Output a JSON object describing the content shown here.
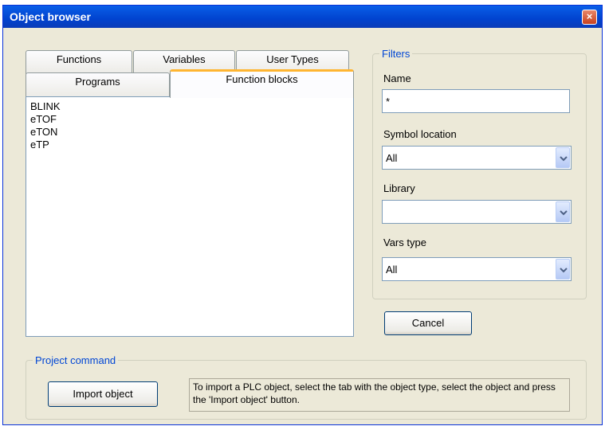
{
  "window": {
    "title": "Object browser",
    "close_label": "×"
  },
  "tabs": {
    "row_back": [
      {
        "label": "Functions"
      },
      {
        "label": "Variables"
      },
      {
        "label": "User Types"
      }
    ],
    "row_front": [
      {
        "label": "Programs"
      },
      {
        "label": "Function blocks",
        "active": true
      }
    ]
  },
  "object_list": {
    "items": [
      "BLINK",
      "eTOF",
      "eTON",
      "eTP"
    ]
  },
  "filters": {
    "legend": "Filters",
    "name_label": "Name",
    "name_value": "*",
    "symbol_location_label": "Symbol location",
    "symbol_location_value": "All",
    "library_label": "Library",
    "library_value": "",
    "vars_type_label": "Vars type",
    "vars_type_value": "All"
  },
  "buttons": {
    "cancel_label": "Cancel",
    "import_label": "Import object"
  },
  "project_command": {
    "legend": "Project command",
    "info_text": "To import a PLC object, select the tab with the object type, select the object and press the 'Import object' button."
  }
}
